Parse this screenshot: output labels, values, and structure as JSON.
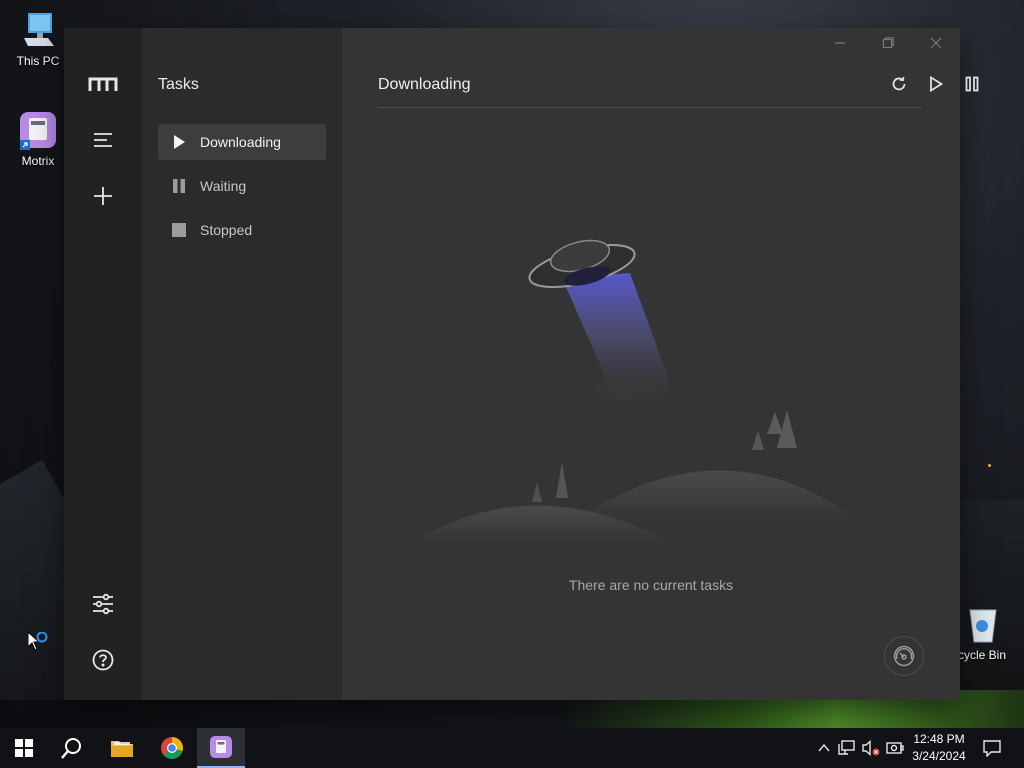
{
  "desktop": {
    "icons": [
      {
        "label": "This PC",
        "icon": "computer-icon"
      },
      {
        "label": "Motrix",
        "icon": "motrix-app-icon"
      },
      {
        "label": "cycle Bin",
        "icon": "recycle-bin-icon"
      }
    ]
  },
  "app": {
    "name": "Motrix",
    "rail": {
      "logo_icon": "motrix-m-logo-icon",
      "menu_icon": "hamburger-menu-icon",
      "add_icon": "plus-icon",
      "settings_icon": "sliders-settings-icon",
      "help_icon": "help-circle-icon"
    },
    "sidebar": {
      "title": "Tasks",
      "items": [
        {
          "label": "Downloading",
          "icon": "play-icon",
          "active": true
        },
        {
          "label": "Waiting",
          "icon": "pause-icon",
          "active": false
        },
        {
          "label": "Stopped",
          "icon": "stop-square-icon",
          "active": false
        }
      ]
    },
    "main": {
      "title": "Downloading",
      "toolbar": {
        "refresh_icon": "refresh-icon",
        "resume_all_icon": "play-outline-icon",
        "pause_all_icon": "pause-outline-icon"
      },
      "empty_message": "There are no current tasks",
      "empty_illustration": "ufo-illustration",
      "speedometer_icon": "speedometer-icon"
    },
    "window_controls": [
      "minimize-icon",
      "maximize-icon",
      "close-icon"
    ]
  },
  "taskbar": {
    "items": [
      "windows-start-icon",
      "search-icon",
      "file-explorer-icon",
      "chrome-icon",
      "motrix-taskbar-icon"
    ],
    "active_item": "motrix-taskbar-icon",
    "tray": [
      "chevron-up-icon",
      "network-icon",
      "volume-muted-icon",
      "battery-icon"
    ],
    "time": "12:48 PM",
    "date": "3/24/2024",
    "notification_icon": "notification-icon"
  },
  "colors": {
    "rail_bg": "#222222",
    "sidebar_bg": "#2b2b2b",
    "main_bg": "#343434",
    "active_item_bg": "#3d3d3d",
    "ufo_beam": "#5a5ad8"
  }
}
